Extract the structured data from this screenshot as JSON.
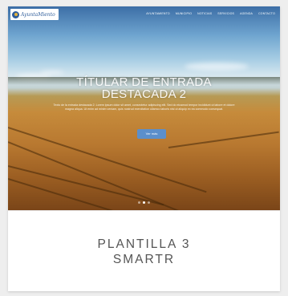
{
  "card": {
    "caption_line1": "PLANTILLA 3",
    "caption_line2": "SMARTR"
  },
  "thumbnail": {
    "logo_text": "AyuntaMiento",
    "nav_links": [
      "AYUNTAMIENTO",
      "MUNICIPIO",
      "NOTICIAS",
      "SERVICIOS",
      "AGENDA",
      "CONTACTO"
    ],
    "hero_title_line1": "TÍTULAR DE ENTRADA",
    "hero_title_line2": "DESTACADA 2",
    "hero_body": "Texto de la entrada destacada 2. Lorem ipsum dolor sit amet, consectetur adipiscing elit. Sed do eiusmod tempor incididunt ut labore et dolore magna aliqua. Ut enim ad minim veniam, quis nostrud exercitation ullamco laboris nisi ut aliquip ex ea commodo consequat.",
    "hero_button_label": "Ver más",
    "slider_dots": 3,
    "active_dot": 1
  },
  "colors": {
    "button": "#5b8fcb",
    "caption_text": "#555555",
    "logo_blue": "#2d5c9a"
  }
}
